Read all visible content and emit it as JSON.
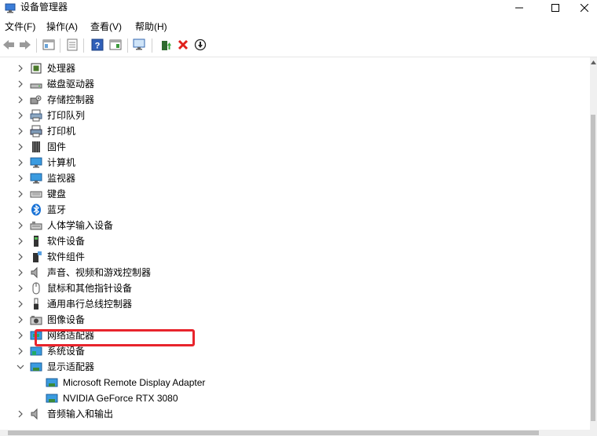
{
  "window": {
    "title": "设备管理器",
    "minimize_icon": "minimize-icon",
    "maximize_icon": "maximize-icon",
    "close_icon": "close-icon"
  },
  "menu": {
    "items": [
      "文件(F)",
      "操作(A)",
      "查看(V)",
      "帮助(H)"
    ]
  },
  "toolbar": {
    "buttons": [
      "back-icon",
      "forward-icon",
      "properties-icon",
      "list-icon",
      "help-icon",
      "console-icon",
      "scan-icon",
      "update-driver-icon",
      "uninstall-icon",
      "disable-icon"
    ]
  },
  "tree": {
    "items": [
      {
        "label": "处理器",
        "icon": "processor-icon",
        "expanded": false
      },
      {
        "label": "磁盘驱动器",
        "icon": "disk-drive-icon",
        "expanded": false
      },
      {
        "label": "存储控制器",
        "icon": "storage-controller-icon",
        "expanded": false
      },
      {
        "label": "打印队列",
        "icon": "print-queue-icon",
        "expanded": false
      },
      {
        "label": "打印机",
        "icon": "printer-icon",
        "expanded": false
      },
      {
        "label": "固件",
        "icon": "firmware-icon",
        "expanded": false
      },
      {
        "label": "计算机",
        "icon": "computer-icon",
        "expanded": false
      },
      {
        "label": "监视器",
        "icon": "monitor-icon",
        "expanded": false
      },
      {
        "label": "键盘",
        "icon": "keyboard-icon",
        "expanded": false
      },
      {
        "label": "蓝牙",
        "icon": "bluetooth-icon",
        "expanded": false
      },
      {
        "label": "人体学输入设备",
        "icon": "hid-icon",
        "expanded": false
      },
      {
        "label": "软件设备",
        "icon": "software-device-icon",
        "expanded": false
      },
      {
        "label": "软件组件",
        "icon": "software-component-icon",
        "expanded": false
      },
      {
        "label": "声音、视频和游戏控制器",
        "icon": "sound-icon",
        "expanded": false
      },
      {
        "label": "鼠标和其他指针设备",
        "icon": "mouse-icon",
        "expanded": false
      },
      {
        "label": "通用串行总线控制器",
        "icon": "usb-icon",
        "expanded": false
      },
      {
        "label": "图像设备",
        "icon": "camera-icon",
        "expanded": false
      },
      {
        "label": "网络适配器",
        "icon": "network-adapter-icon",
        "expanded": false
      },
      {
        "label": "系统设备",
        "icon": "system-device-icon",
        "expanded": false
      },
      {
        "label": "显示适配器",
        "icon": "display-adapter-icon",
        "expanded": true
      }
    ],
    "display_children": [
      {
        "label": "Microsoft Remote Display Adapter",
        "icon": "display-adapter-icon"
      },
      {
        "label": "NVIDIA GeForce RTX 3080",
        "icon": "display-adapter-icon",
        "highlighted": true
      }
    ],
    "last_item": {
      "label": "音频输入和输出",
      "icon": "audio-io-icon",
      "expanded": false
    }
  },
  "colors": {
    "highlight_border": "#e8242c",
    "uninstall_red": "#e0201b"
  }
}
